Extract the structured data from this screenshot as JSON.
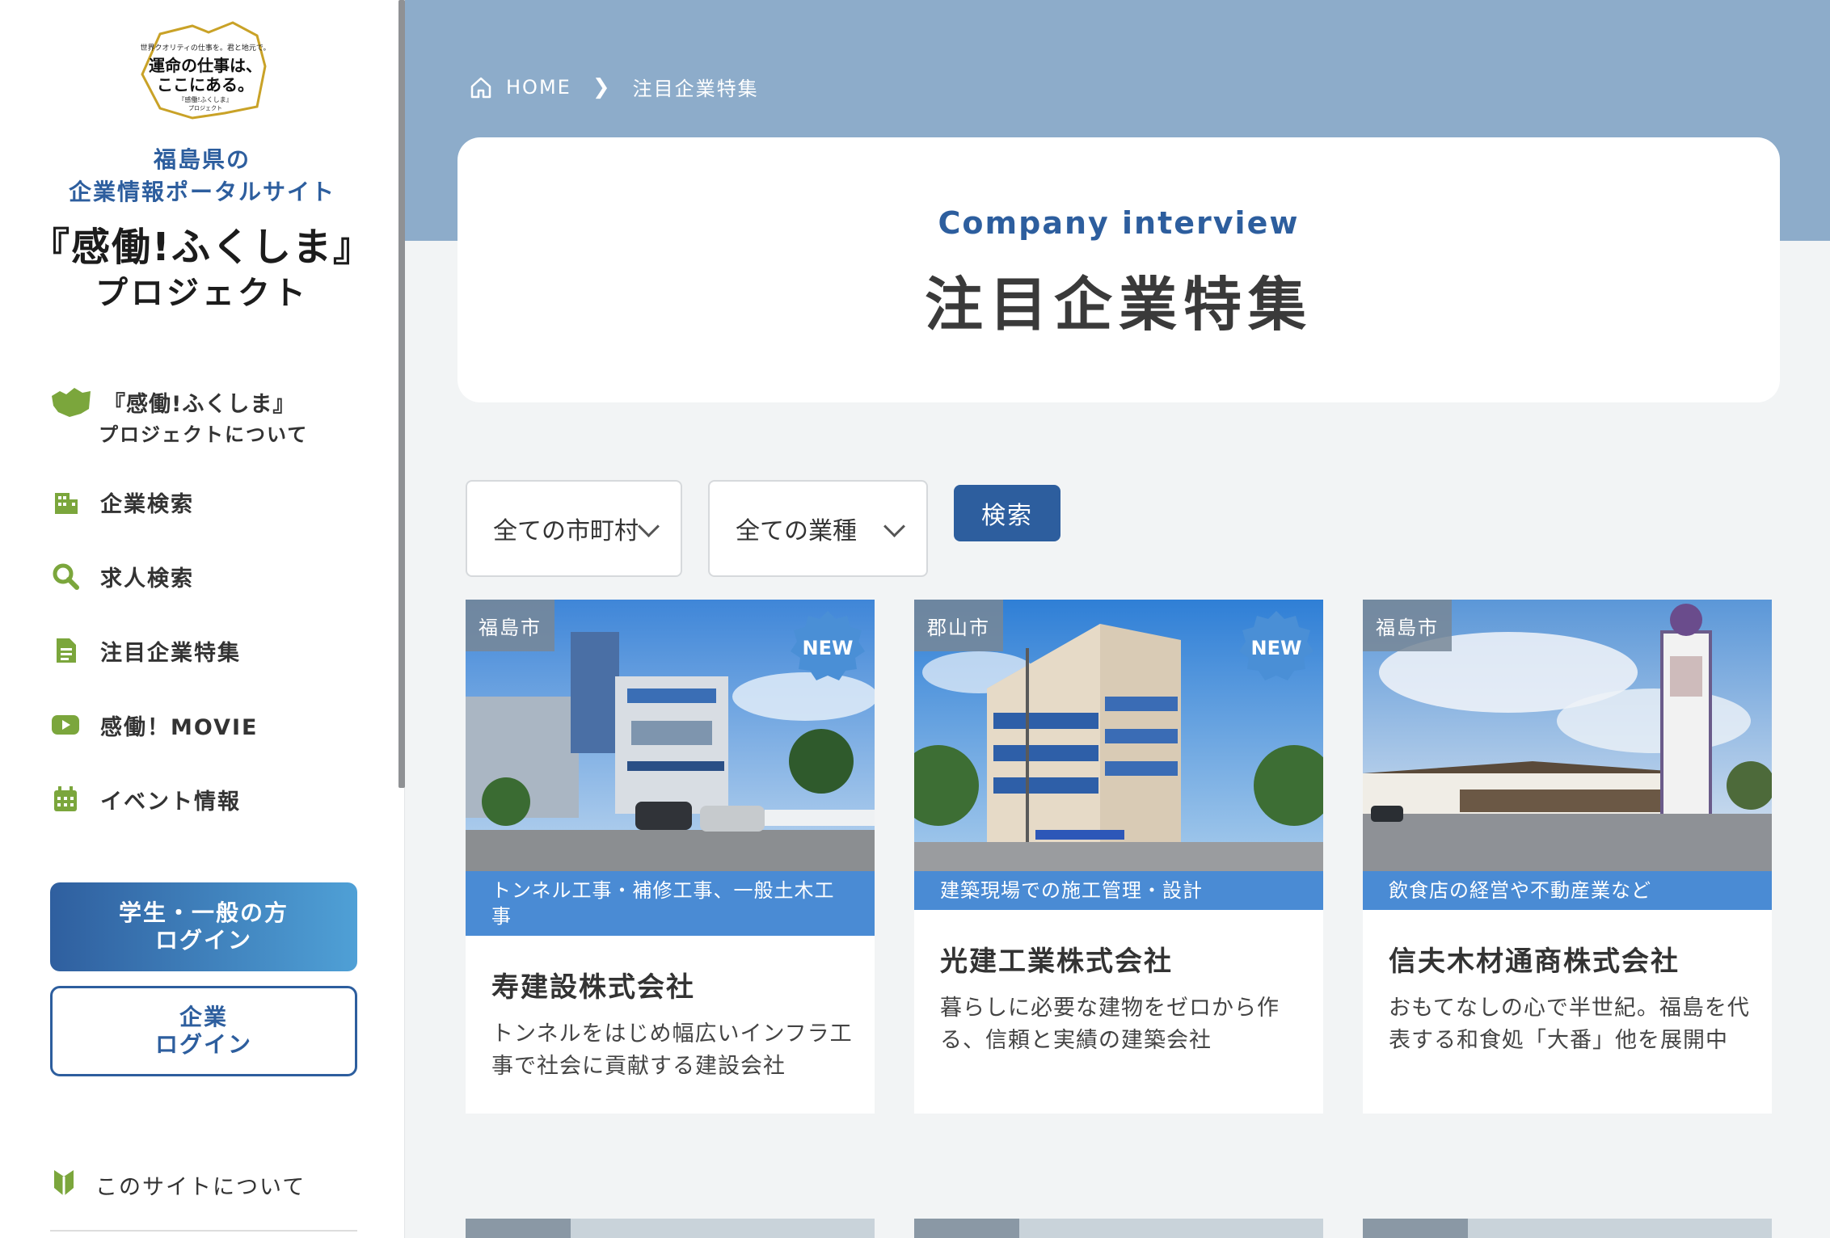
{
  "sidebar": {
    "badge_lines": [
      "世界クオリティの仕事を。君と地元で。",
      "運命の仕事は、",
      "ここにある。",
      "『感働!ふくしま』",
      "プロジェクト"
    ],
    "desc_line1": "福島県の",
    "desc_line2": "企業情報ポータルサイト",
    "title_line1": "『感働!ふくしま』",
    "title_line2": "プロジェクト",
    "about": {
      "line1": "『感働!ふくしま』",
      "line2": "プロジェクトについて",
      "icon": "fukushima-map-icon"
    },
    "nav": [
      {
        "label": "企業検索",
        "icon": "building-icon"
      },
      {
        "label": "求人検索",
        "icon": "search-icon"
      },
      {
        "label": "注目企業特集",
        "icon": "document-icon"
      },
      {
        "label": "感働！MOVIE",
        "icon": "play-icon"
      },
      {
        "label": "イベント情報",
        "icon": "calendar-icon"
      }
    ],
    "student_login": {
      "line1": "学生・一般の方",
      "line2": "ログイン"
    },
    "company_login": {
      "line1": "企業",
      "line2": "ログイン"
    },
    "site_about": "このサイトについて"
  },
  "breadcrumb": {
    "home": "HOME",
    "current": "注目企業特集"
  },
  "hero": {
    "subtitle": "Company interview",
    "title": "注目企業特集"
  },
  "filters": {
    "city": "全ての市町村",
    "industry": "全ての業種",
    "search": "検索"
  },
  "new_label": "NEW",
  "cards": [
    {
      "city": "福島市",
      "is_new": true,
      "industry": "トンネル工事・補修工事、一般土木工事",
      "name": "寿建設株式会社",
      "desc": "トンネルをはじめ幅広いインフラ工事で社会に貢献する建設会社"
    },
    {
      "city": "郡山市",
      "is_new": true,
      "industry": "建築現場での施工管理・設計",
      "name": "光建工業株式会社",
      "desc": "暮らしに必要な建物をゼロから作る、信頼と実績の建築会社"
    },
    {
      "city": "福島市",
      "is_new": false,
      "industry": "飲食店の経営や不動産業など",
      "name": "信夫木材通商株式会社",
      "desc": "おもてなしの心で半世紀。福島を代表する和食処「大番」他を展開中"
    }
  ],
  "colors": {
    "primary": "#2d5e9e",
    "band": "#8dacca",
    "industry_bar": "#4a8bd4",
    "nav_icon": "#7ba63c"
  }
}
